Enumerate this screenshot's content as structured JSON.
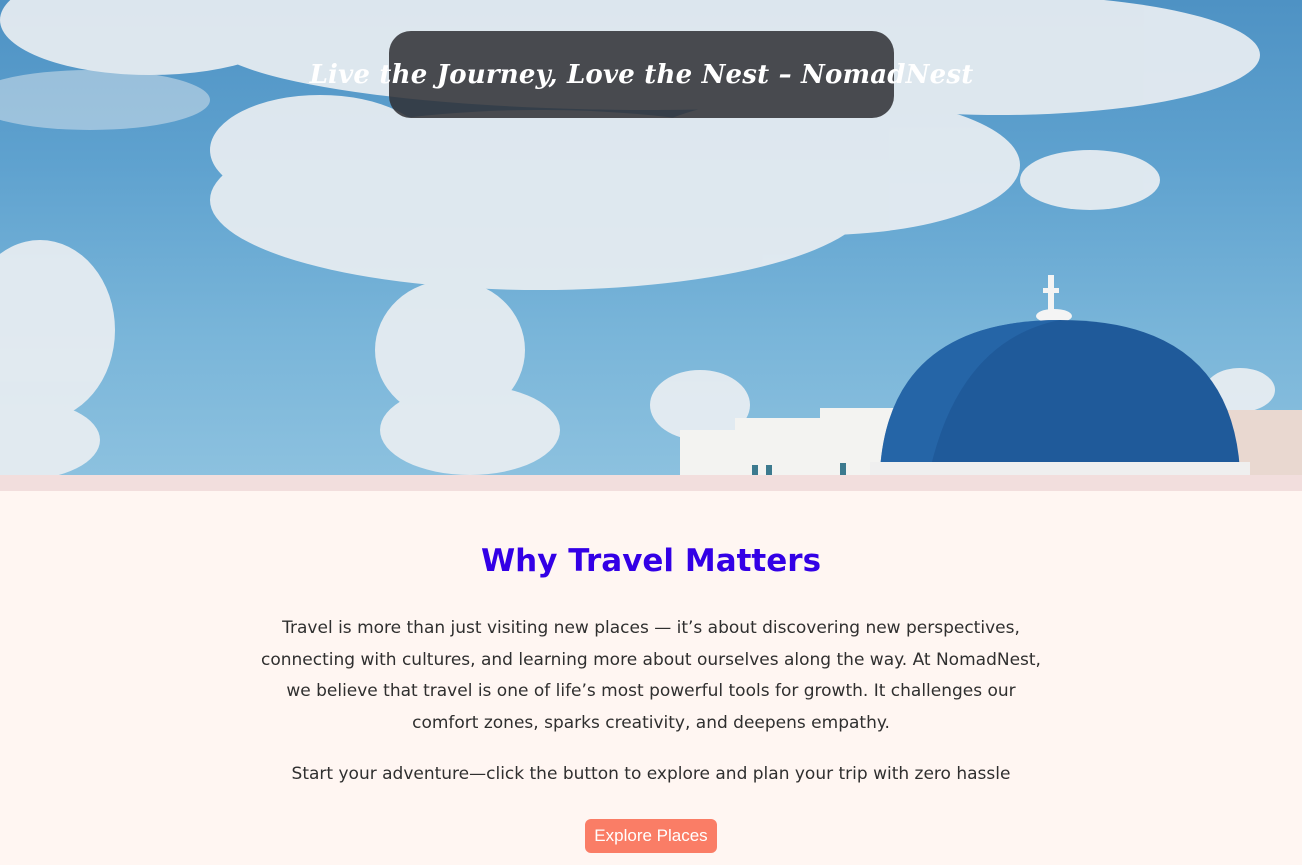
{
  "hero": {
    "tagline": "Live the Journey, Love the Nest – NomadNest",
    "image_description_icon": "santorini-dome-photo"
  },
  "section": {
    "heading": "Why Travel Matters",
    "paragraph": "Travel is more than just visiting new places — it’s about discovering new perspectives, connecting with cultures, and learning more about ourselves along the way. At NomadNest, we believe that travel is one of life’s most powerful tools for growth. It challenges our comfort zones, sparks creativity, and deepens empathy.",
    "cta_text": "Start your adventure—click the button to explore and plan your trip with zero hassle",
    "button_label": "Explore Places"
  },
  "colors": {
    "heading": "#3300e6",
    "button": "#fa7d66",
    "background": "#fff6f2",
    "band": "#f2dedd",
    "dome": "#1f5a9a"
  }
}
